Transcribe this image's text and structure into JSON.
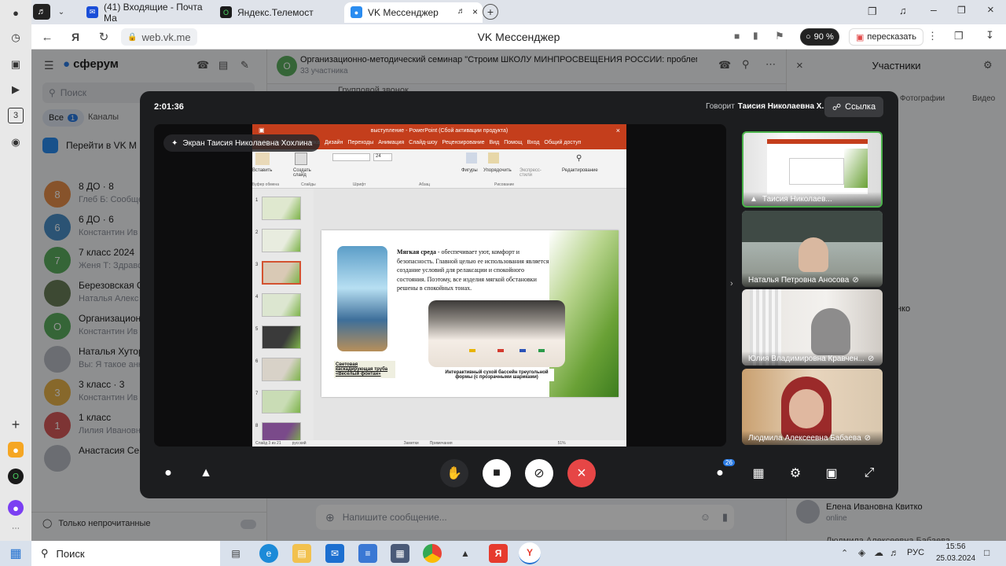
{
  "browser": {
    "tabs": [
      {
        "label": "(41) Входящие - Почта Ма",
        "icon": "mail-icon"
      },
      {
        "label": "Яндекс.Телемост",
        "icon": "telemost-icon"
      },
      {
        "label": "VK Мессенджер",
        "icon": "vk-messenger-icon"
      }
    ],
    "url": "web.vk.me",
    "page_title": "VK Мессенджер",
    "zoom": "90 %",
    "translate_label": "пересказать"
  },
  "sidebar": {
    "brand": "сферум",
    "search_placeholder": "Поиск",
    "filter_all": "Все",
    "filter_all_count": "1",
    "filter_channels": "Каналы",
    "goto_vk": "Перейти в VK М",
    "unread_only": "Только непрочитанные",
    "chats": [
      {
        "initial": "8",
        "name": "8 ДО · 8",
        "msg": "Глеб Б: Сообщен",
        "color": "#e8904a"
      },
      {
        "initial": "6",
        "name": "6 ДО · 6",
        "msg": "Константин Ив",
        "color": "#4a90c8"
      },
      {
        "initial": "7",
        "name": "7 класс 2024",
        "msg": "Женя Т: Здравст",
        "color": "#5cae5f"
      },
      {
        "initial": "",
        "name": "Березовская С",
        "msg": "Наталья Алекс",
        "color": "#6a7f58"
      },
      {
        "initial": "О",
        "name": "Организацион",
        "msg": "Константин Ив",
        "color": "#5cae5f"
      },
      {
        "initial": "",
        "name": "Наталья Хутор",
        "msg": "Вы: Я такое анк",
        "color": "#b8bcc4"
      },
      {
        "initial": "3",
        "name": "3 класс · 3",
        "msg": "Константин Ив",
        "color": "#e8b44a"
      },
      {
        "initial": "1",
        "name": "1 класс",
        "msg": "Лилия Ивановн",
        "color": "#d85a5a"
      },
      {
        "initial": "",
        "name": "Анастасия Сергеевна Светко",
        "msg": "",
        "color": "#b8bcc4"
      }
    ]
  },
  "chat_header": {
    "title": "Организационно-методический семинар \"Строим ШКОЛУ МИНПРОСВЕЩЕНИЯ РОССИИ: проблемы, опыт\"",
    "subtitle": "33 участника",
    "avatar_initial": "О",
    "behind_text": "Групповой звонок"
  },
  "participants_panel": {
    "title": "Участники",
    "tab_photos": "Фотографии",
    "tab_video": "Видео",
    "names": [
      "ков",
      "ирогова",
      "Аносова",
      "лейник",
      "",
      "ндровна Бондаренко",
      "Иванчук",
      "а Кравченко",
      "Саенко",
      "Хохлина",
      "Коваленко"
    ],
    "last_name": "Елена Ивановна Квитко",
    "last_status": "online",
    "last_cut": "Людмила Алексеевна Бабаева"
  },
  "composer": {
    "placeholder": "Напишите сообщение..."
  },
  "call": {
    "timer": "2:01:36",
    "speaking_prefix": "Говорит",
    "speaker": "Таисия Николаевна Х.",
    "link_label": "Ссылка",
    "screen_label": "Экран Таисия Николаевна Хохлина",
    "participant_count": "26",
    "tiles": [
      {
        "label": "Таисия Николаев...",
        "muted": false,
        "active": true
      },
      {
        "label": "Наталья Петровна Аносова",
        "muted": true,
        "active": false
      },
      {
        "label": "Юлия Владимировна Кравчен...",
        "muted": true,
        "active": false
      },
      {
        "label": "Людмила Алексеевна Бабаева",
        "muted": true,
        "active": false
      }
    ]
  },
  "ppt": {
    "window_title": "выступление - PowerPoint (Сбой активации продукта)",
    "menu": [
      "Файл",
      "Главная",
      "Вставка",
      "Дизайн",
      "Переходы",
      "Анимация",
      "Слайд-шоу",
      "Рецензирование",
      "Вид",
      "Помощ",
      "Вход",
      "Общий доступ"
    ],
    "ribbon": [
      "Вставить",
      "Создать слайд",
      "Фигуры",
      "Упорядочить",
      "Экспресс-стили",
      "Редактирование"
    ],
    "groups": [
      "Буфер обмена",
      "Слайды",
      "Шрифт",
      "Абзац",
      "Рисование"
    ],
    "font_size": "24",
    "slide_heading": "Мягкая среда",
    "slide_text": " - обеспечивает уют, комфорт и безопасность. Главной целью ее использования является создание условий для релаксации и спокойного состояния. Поэтому, все изделия мягкой обстановки решены в спокойных тонах.",
    "caption_tube": "Световая каскадирующая труба «Веселый фонтан»",
    "caption_pool": "Интерактивный сухой бассейн треугольной формы (с прозрачными шариками)",
    "status_left": "Слайд 3 из 21",
    "status_lang": "русский",
    "status_notes": "Заметки",
    "status_comments": "Примечания",
    "status_zoom": "51%",
    "thumb_numbers": [
      "1",
      "2",
      "3",
      "4",
      "5",
      "6",
      "7",
      "8"
    ]
  },
  "taskbar": {
    "search": "Поиск",
    "lang": "РУС",
    "time": "15:56",
    "date": "25.03.2024"
  }
}
